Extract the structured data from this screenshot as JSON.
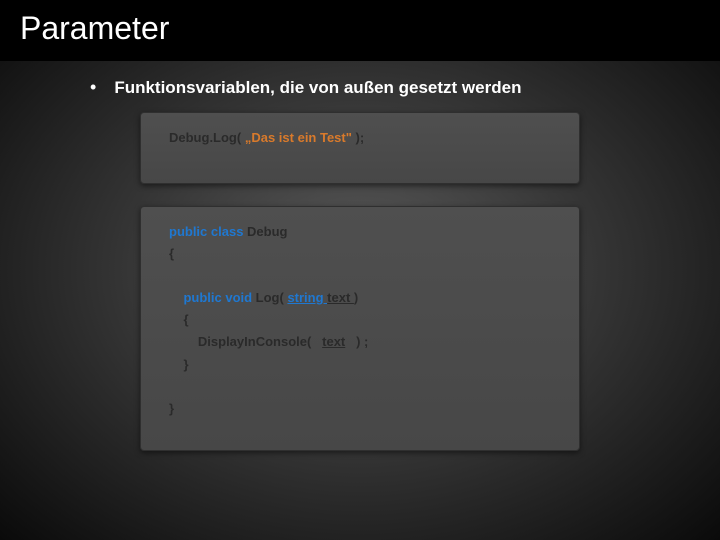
{
  "title": "Parameter",
  "bullet": "Funktionsvariablen, die von außen gesetzt werden",
  "code1": {
    "t1": "Debug.Log",
    "t2": "( ",
    "t3": "„Das ist ein Test\" ",
    "t4": ");"
  },
  "code2": {
    "l1a": "public class ",
    "l1b": "Debug",
    "l2": "{",
    "l3": "",
    "l4a": "    public void ",
    "l4b": "Log( ",
    "l4c": "string ",
    "l4d": "text ",
    "l4e": ")",
    "l5": "    {",
    "l6a": "        DisplayInConsole(   ",
    "l6b": "text",
    "l6c": "   ) ;",
    "l7": "    }",
    "l8": "",
    "l9": "}"
  }
}
